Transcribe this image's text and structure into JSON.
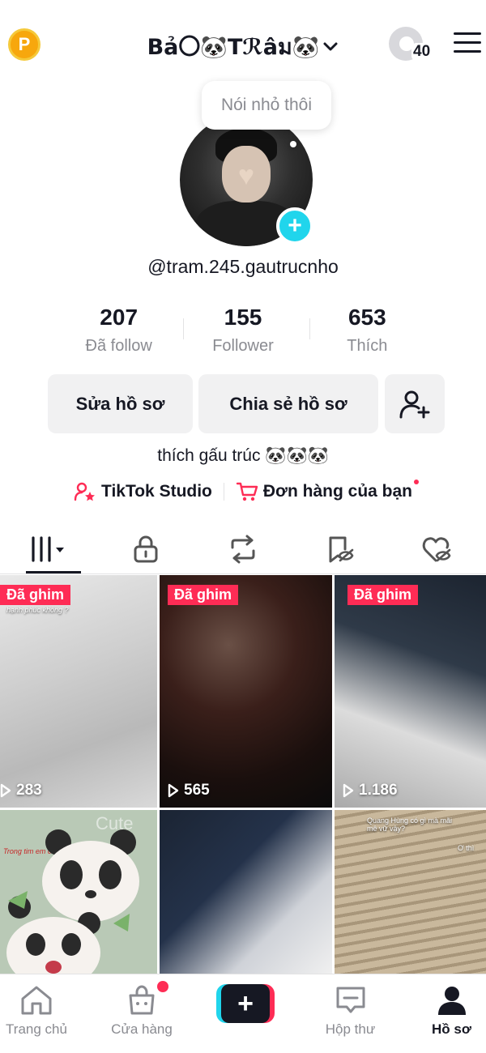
{
  "header": {
    "coin_letter": "P",
    "title": "Bả〇🐼Tℛâม🐼",
    "visitor_count": "40"
  },
  "profile": {
    "note": "Nói nhỏ thôi",
    "add_symbol": "+",
    "username": "@tram.245.gautrucnho",
    "stats": [
      {
        "value": "207",
        "label": "Đã follow"
      },
      {
        "value": "155",
        "label": "Follower"
      },
      {
        "value": "653",
        "label": "Thích"
      }
    ],
    "edit_label": "Sửa hồ sơ",
    "share_label": "Chia sẻ hồ sơ",
    "bio": "thích gấu trúc 🐼🐼🐼",
    "studio_label": "TikTok Studio",
    "orders_label": "Đơn hàng của bạn"
  },
  "videos": [
    {
      "pinned": "Đã ghim",
      "views": "283",
      "caption": "hạnh phúc không ?"
    },
    {
      "pinned": "Đã ghim",
      "views": "565"
    },
    {
      "pinned": "Đã ghim",
      "views": "1.186"
    },
    {
      "caption": "Trong tim em có ai vậy?",
      "sticker": "Cute"
    },
    {},
    {
      "caption": "Quang Hùng có gì mà mãi mê vữ vậy?",
      "caption2": "Ơ thì"
    }
  ],
  "nav": {
    "home": "Trang chủ",
    "shop": "Cửa hàng",
    "create": "+",
    "inbox": "Hộp thư",
    "profile": "Hồ sơ"
  },
  "colors": {
    "accent_red": "#fe2c55",
    "accent_cyan": "#20d5ec",
    "text_primary": "#161823",
    "text_secondary": "#8a8b91"
  }
}
